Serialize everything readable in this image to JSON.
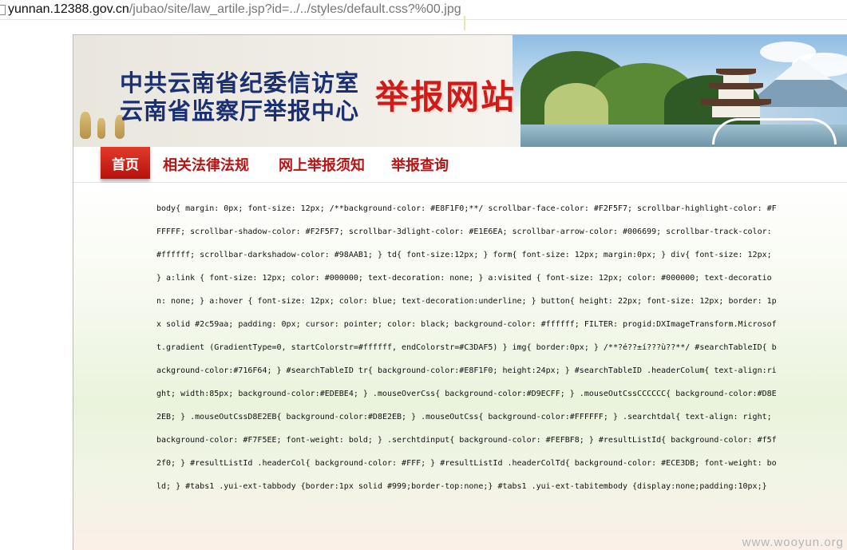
{
  "browser": {
    "url_host": "yunnan.12388.gov.cn",
    "url_path": "/jubao/site/law_artile.jsp?id=../../styles/default.css?%00.jpg"
  },
  "banner": {
    "title_line1": "中共云南省纪委信访室",
    "title_line2": "云南省监察厅举报中心",
    "site_label": "举报网站"
  },
  "nav": {
    "home": "首页",
    "items": [
      "相关法律法规",
      "网上举报须知",
      "举报查询"
    ]
  },
  "content": {
    "css_text": "body{ margin: 0px; font-size: 12px; /**background-color: #E8F1F0;**/ scrollbar-face-color: #F2F5F7; scrollbar-highlight-color: #FFFFFF; scrollbar-shadow-color: #F2F5F7; scrollbar-3dlight-color: #E1E6EA; scrollbar-arrow-color: #006699; scrollbar-track-color: #ffffff; scrollbar-darkshadow-color: #98AAB1; } td{ font-size:12px; } form{ font-size: 12px; margin:0px; } div{ font-size: 12px; } a:link { font-size: 12px; color: #000000; text-decoration: none; } a:visited { font-size: 12px; color: #000000; text-decoration: none; } a:hover { font-size: 12px; color: blue; text-decoration:underline; } button{ height: 22px; font-size: 12px; border: 1px solid #2c59aa; padding: 0px; cursor: pointer; color: black; background-color: #ffffff; FILTER: progid:DXImageTransform.Microsoft.gradient (GradientType=0, startColorstr=#ffffff, endColorstr=#C3DAF5) } img{ border:0px; } /**?é??±í???ù??**/ #searchTableID{ background-color:#716F64; } #searchTableID tr{ background-color:#E8F1F0; height:24px; } #searchTableID .headerColum{ text-align:right; width:85px; background-color:#EDEBE4; } .mouseOverCss{ background-color:#D9ECFF; } .mouseOutCssCCCCCC{ background-color:#D8E2EB; } .mouseOutCssD8E2EB{ background-color:#D8E2EB; } .mouseOutCss{ background-color:#FFFFFF; } .searchtdal{ text-align: right; background-color: #F7F5EE; font-weight: bold; } .serchtdinput{ background-color: #FEFBF8; } #resultListId{ background-color: #f5f2f0; } #resultListId .headerCol{ background-color: #FFF; } #resultListId .headerColTd{ background-color: #ECE3DB; font-weight: bold; } #tabs1 .yui-ext-tabbody {border:1px solid #999;border-top:none;} #tabs1 .yui-ext-tabitembody {display:none;padding:10px;}"
  },
  "watermark": "www.wooyun.org",
  "colors": {
    "title_blue": "#1b2f73",
    "accent_red": "#d11b1b",
    "nav_red": "#b81414"
  }
}
